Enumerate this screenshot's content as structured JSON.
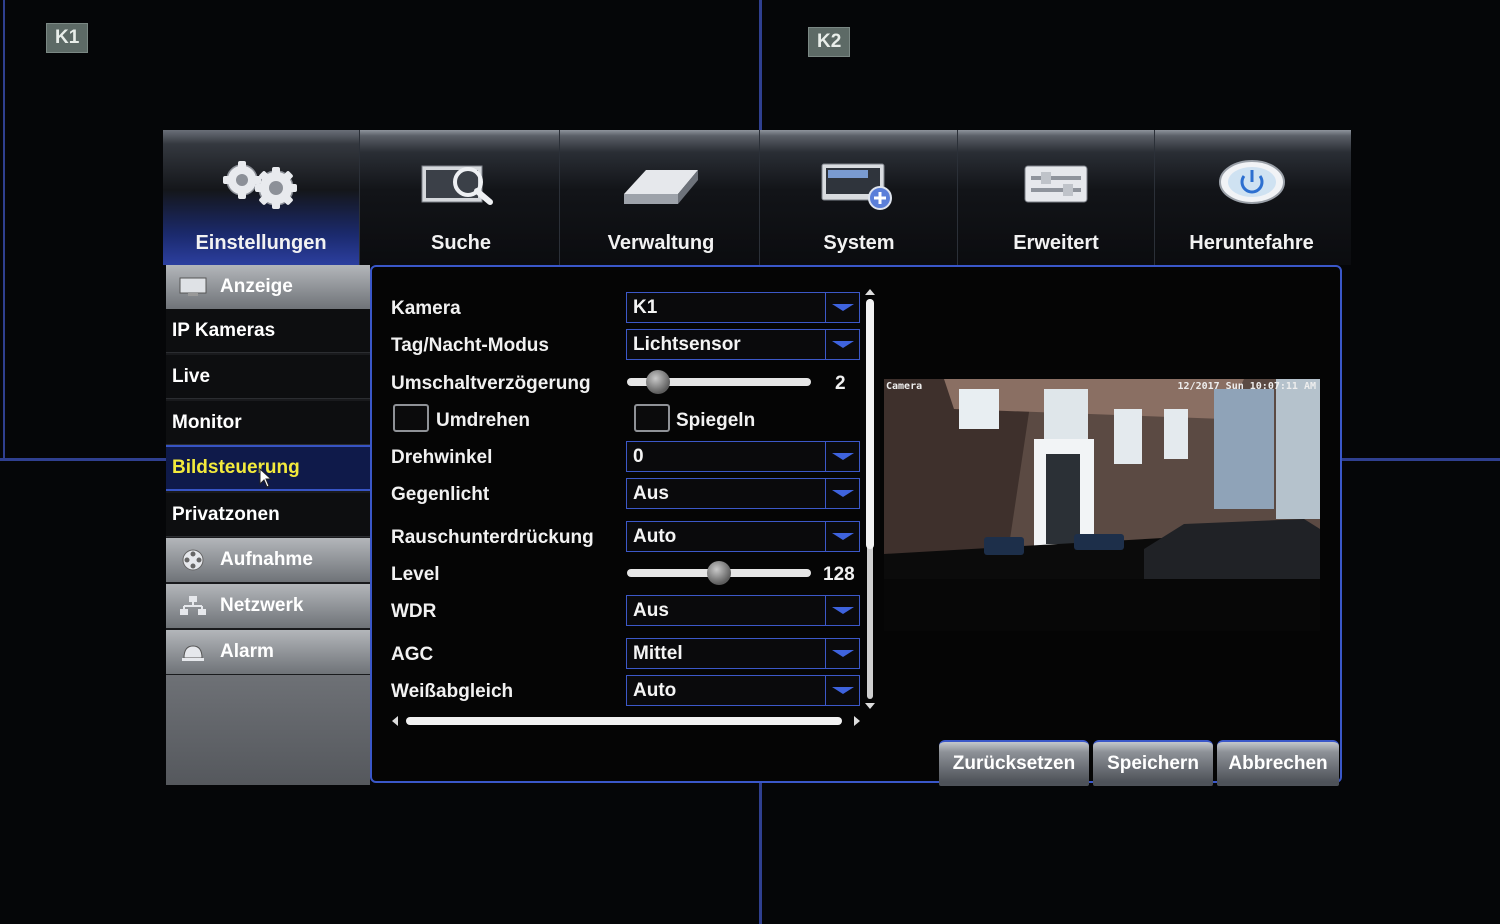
{
  "camera_labels": {
    "k1": "K1",
    "k2": "K2"
  },
  "tabs": [
    {
      "label": "Einstellungen",
      "icon": "gears-icon",
      "active": true
    },
    {
      "label": "Suche",
      "icon": "search-icon",
      "active": false
    },
    {
      "label": "Verwaltung",
      "icon": "hard-drive-icon",
      "active": false
    },
    {
      "label": "System",
      "icon": "system-monitor-icon",
      "active": false
    },
    {
      "label": "Erweitert",
      "icon": "advanced-panel-icon",
      "active": false
    },
    {
      "label": "Heruntefahre",
      "icon": "power-icon",
      "active": false
    }
  ],
  "sidebar": {
    "items": [
      {
        "label": "Anzeige",
        "type": "group",
        "icon": "monitor-icon"
      },
      {
        "label": "IP Kameras",
        "type": "sub"
      },
      {
        "label": "Live",
        "type": "sub"
      },
      {
        "label": "Monitor",
        "type": "sub"
      },
      {
        "label": "Bildsteuerung",
        "type": "sub",
        "selected": true
      },
      {
        "label": "Privatzonen",
        "type": "sub"
      },
      {
        "label": "Aufnahme",
        "type": "group",
        "icon": "film-reel-icon"
      },
      {
        "label": "Netzwerk",
        "type": "group",
        "icon": "network-icon"
      },
      {
        "label": "Alarm",
        "type": "group",
        "icon": "alarm-bell-icon"
      }
    ]
  },
  "form": {
    "kamera": {
      "label": "Kamera",
      "value": "K1"
    },
    "tag_nacht": {
      "label": "Tag/Nacht-Modus",
      "value": "Lichtsensor"
    },
    "umschalt": {
      "label": "Umschaltverzögerung",
      "value": "2",
      "fraction": 0.12
    },
    "umdrehen": {
      "label": "Umdrehen",
      "checked": false
    },
    "spiegeln": {
      "label": "Spiegeln",
      "checked": false
    },
    "drehwinkel": {
      "label": "Drehwinkel",
      "value": "0"
    },
    "gegenlicht": {
      "label": "Gegenlicht",
      "value": "Aus"
    },
    "rausch": {
      "label": "Rauschunterdrückung",
      "value": "Auto"
    },
    "level": {
      "label": "Level",
      "value": "128",
      "fraction": 0.5
    },
    "wdr": {
      "label": "WDR",
      "value": "Aus"
    },
    "agc": {
      "label": "AGC",
      "value": "Mittel"
    },
    "weiss": {
      "label": "Weißabgleich",
      "value": "Auto"
    }
  },
  "preview": {
    "osd_left": "Camera",
    "osd_right": "12/2017 Sun 10:07:11 AM"
  },
  "buttons": {
    "reset": "Zurücksetzen",
    "save": "Speichern",
    "cancel": "Abbrechen"
  },
  "colors": {
    "accent": "#3a57c9",
    "selected_text": "#f3ea3c",
    "dropdown_arrow": "#3e63de"
  }
}
